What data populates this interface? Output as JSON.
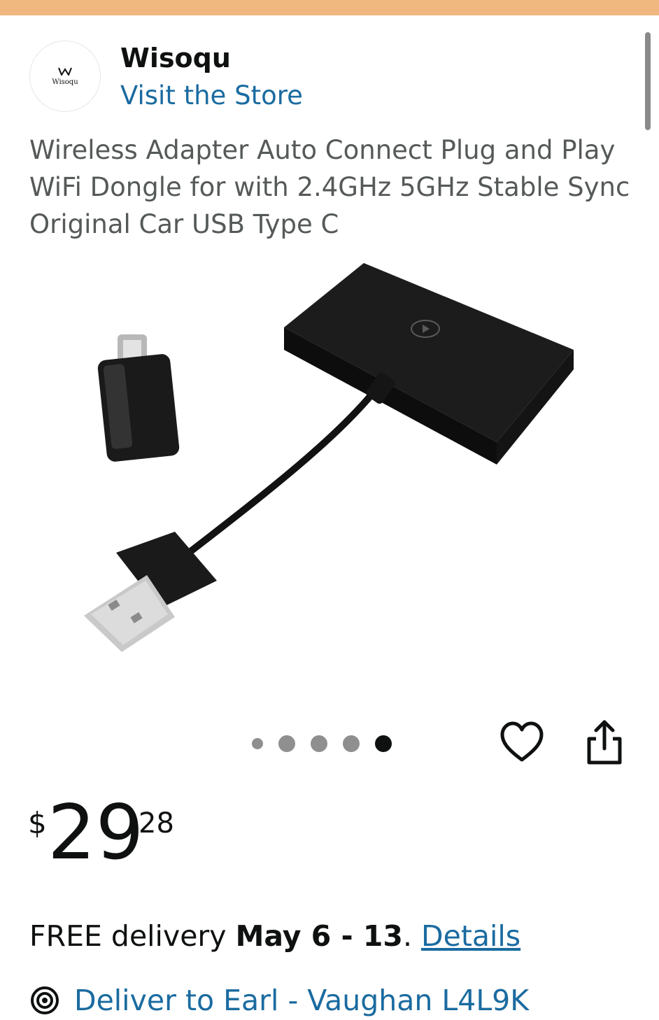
{
  "brand": {
    "logo_text": "Wisoqu",
    "name": "Wisoqu",
    "visit_store_label": "Visit the Store"
  },
  "product": {
    "title": "Wireless Adapter Auto Connect Plug and Play WiFi Dongle for with 2.4GHz 5GHz Stable Sync Original Car USB Type C"
  },
  "gallery": {
    "image_count": 5,
    "active_index": 4
  },
  "price": {
    "symbol": "$",
    "whole": "29",
    "fraction": "28"
  },
  "delivery": {
    "prefix": "FREE delivery ",
    "dates": "May 6 - 13",
    "suffix": ". ",
    "details_label": "Details"
  },
  "deliver_to": {
    "label": "Deliver to Earl - Vaughan L4L9K"
  },
  "colors": {
    "top_bar": "#f0b77e",
    "link": "#1a6ba0",
    "text": "#0f1111",
    "muted": "#565959"
  }
}
